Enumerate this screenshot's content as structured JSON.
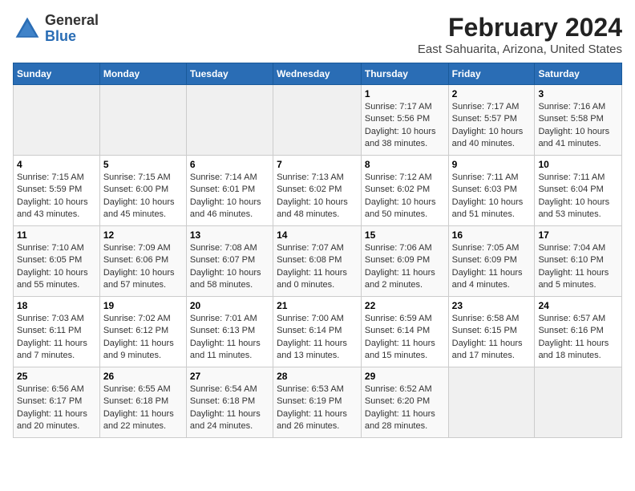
{
  "header": {
    "logo_general": "General",
    "logo_blue": "Blue",
    "title": "February 2024",
    "subtitle": "East Sahuarita, Arizona, United States"
  },
  "weekdays": [
    "Sunday",
    "Monday",
    "Tuesday",
    "Wednesday",
    "Thursday",
    "Friday",
    "Saturday"
  ],
  "weeks": [
    [
      {
        "day": "",
        "info": ""
      },
      {
        "day": "",
        "info": ""
      },
      {
        "day": "",
        "info": ""
      },
      {
        "day": "",
        "info": ""
      },
      {
        "day": "1",
        "info": "Sunrise: 7:17 AM\nSunset: 5:56 PM\nDaylight: 10 hours and 38 minutes."
      },
      {
        "day": "2",
        "info": "Sunrise: 7:17 AM\nSunset: 5:57 PM\nDaylight: 10 hours and 40 minutes."
      },
      {
        "day": "3",
        "info": "Sunrise: 7:16 AM\nSunset: 5:58 PM\nDaylight: 10 hours and 41 minutes."
      }
    ],
    [
      {
        "day": "4",
        "info": "Sunrise: 7:15 AM\nSunset: 5:59 PM\nDaylight: 10 hours and 43 minutes."
      },
      {
        "day": "5",
        "info": "Sunrise: 7:15 AM\nSunset: 6:00 PM\nDaylight: 10 hours and 45 minutes."
      },
      {
        "day": "6",
        "info": "Sunrise: 7:14 AM\nSunset: 6:01 PM\nDaylight: 10 hours and 46 minutes."
      },
      {
        "day": "7",
        "info": "Sunrise: 7:13 AM\nSunset: 6:02 PM\nDaylight: 10 hours and 48 minutes."
      },
      {
        "day": "8",
        "info": "Sunrise: 7:12 AM\nSunset: 6:02 PM\nDaylight: 10 hours and 50 minutes."
      },
      {
        "day": "9",
        "info": "Sunrise: 7:11 AM\nSunset: 6:03 PM\nDaylight: 10 hours and 51 minutes."
      },
      {
        "day": "10",
        "info": "Sunrise: 7:11 AM\nSunset: 6:04 PM\nDaylight: 10 hours and 53 minutes."
      }
    ],
    [
      {
        "day": "11",
        "info": "Sunrise: 7:10 AM\nSunset: 6:05 PM\nDaylight: 10 hours and 55 minutes."
      },
      {
        "day": "12",
        "info": "Sunrise: 7:09 AM\nSunset: 6:06 PM\nDaylight: 10 hours and 57 minutes."
      },
      {
        "day": "13",
        "info": "Sunrise: 7:08 AM\nSunset: 6:07 PM\nDaylight: 10 hours and 58 minutes."
      },
      {
        "day": "14",
        "info": "Sunrise: 7:07 AM\nSunset: 6:08 PM\nDaylight: 11 hours and 0 minutes."
      },
      {
        "day": "15",
        "info": "Sunrise: 7:06 AM\nSunset: 6:09 PM\nDaylight: 11 hours and 2 minutes."
      },
      {
        "day": "16",
        "info": "Sunrise: 7:05 AM\nSunset: 6:09 PM\nDaylight: 11 hours and 4 minutes."
      },
      {
        "day": "17",
        "info": "Sunrise: 7:04 AM\nSunset: 6:10 PM\nDaylight: 11 hours and 5 minutes."
      }
    ],
    [
      {
        "day": "18",
        "info": "Sunrise: 7:03 AM\nSunset: 6:11 PM\nDaylight: 11 hours and 7 minutes."
      },
      {
        "day": "19",
        "info": "Sunrise: 7:02 AM\nSunset: 6:12 PM\nDaylight: 11 hours and 9 minutes."
      },
      {
        "day": "20",
        "info": "Sunrise: 7:01 AM\nSunset: 6:13 PM\nDaylight: 11 hours and 11 minutes."
      },
      {
        "day": "21",
        "info": "Sunrise: 7:00 AM\nSunset: 6:14 PM\nDaylight: 11 hours and 13 minutes."
      },
      {
        "day": "22",
        "info": "Sunrise: 6:59 AM\nSunset: 6:14 PM\nDaylight: 11 hours and 15 minutes."
      },
      {
        "day": "23",
        "info": "Sunrise: 6:58 AM\nSunset: 6:15 PM\nDaylight: 11 hours and 17 minutes."
      },
      {
        "day": "24",
        "info": "Sunrise: 6:57 AM\nSunset: 6:16 PM\nDaylight: 11 hours and 18 minutes."
      }
    ],
    [
      {
        "day": "25",
        "info": "Sunrise: 6:56 AM\nSunset: 6:17 PM\nDaylight: 11 hours and 20 minutes."
      },
      {
        "day": "26",
        "info": "Sunrise: 6:55 AM\nSunset: 6:18 PM\nDaylight: 11 hours and 22 minutes."
      },
      {
        "day": "27",
        "info": "Sunrise: 6:54 AM\nSunset: 6:18 PM\nDaylight: 11 hours and 24 minutes."
      },
      {
        "day": "28",
        "info": "Sunrise: 6:53 AM\nSunset: 6:19 PM\nDaylight: 11 hours and 26 minutes."
      },
      {
        "day": "29",
        "info": "Sunrise: 6:52 AM\nSunset: 6:20 PM\nDaylight: 11 hours and 28 minutes."
      },
      {
        "day": "",
        "info": ""
      },
      {
        "day": "",
        "info": ""
      }
    ]
  ]
}
